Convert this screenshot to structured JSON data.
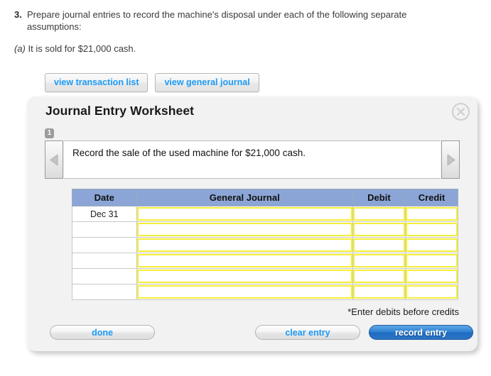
{
  "question": {
    "number": "3.",
    "text": "Prepare journal entries to record the machine's disposal under each of the following separate",
    "text_last_line": "assumptions:",
    "sub_letter": "(a)",
    "sub_text": "It is sold for $21,000 cash."
  },
  "toolbar": {
    "view_transaction_list": "view transaction list",
    "view_general_journal": "view general journal"
  },
  "panel": {
    "title": "Journal Entry Worksheet",
    "close_icon": "close-icon",
    "step_badge": "1",
    "prev_icon": "triangle-left-icon",
    "next_icon": "triangle-right-icon",
    "prompt": "Record the sale of the used machine for $21,000 cash.",
    "note": "*Enter debits before credits"
  },
  "table": {
    "headers": [
      "Date",
      "General Journal",
      "Debit",
      "Credit"
    ],
    "rows": [
      {
        "date": "Dec 31",
        "general_journal": "",
        "debit": "",
        "credit": ""
      },
      {
        "date": "",
        "general_journal": "",
        "debit": "",
        "credit": ""
      },
      {
        "date": "",
        "general_journal": "",
        "debit": "",
        "credit": ""
      },
      {
        "date": "",
        "general_journal": "",
        "debit": "",
        "credit": ""
      },
      {
        "date": "",
        "general_journal": "",
        "debit": "",
        "credit": ""
      },
      {
        "date": "",
        "general_journal": "",
        "debit": "",
        "credit": ""
      }
    ]
  },
  "footer": {
    "done": "done",
    "clear_entry": "clear entry",
    "record_entry": "record entry"
  },
  "colors": {
    "link_blue": "#1b9af7",
    "header_blue": "#8ba6d6",
    "input_yellow": "#f4ee3a",
    "record_blue": "#2f7fd0",
    "panel_grey": "#f2f2f2"
  }
}
